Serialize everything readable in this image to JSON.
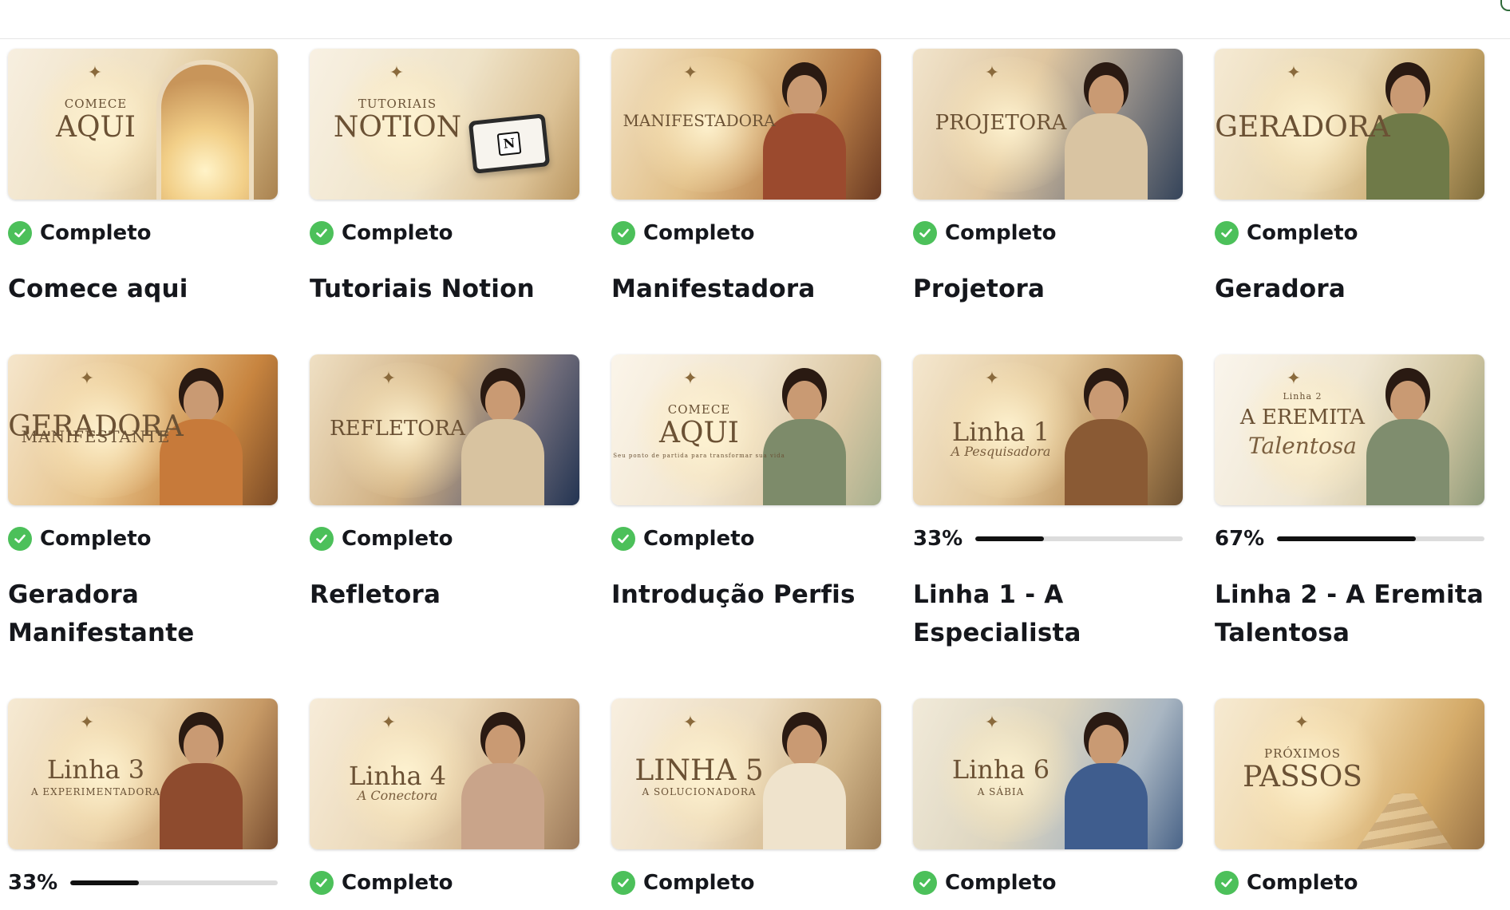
{
  "courses": [
    {
      "title": "Comece aqui",
      "status": "complete",
      "status_label": "Completo",
      "thumb": {
        "small": "COMECE",
        "big": "AQUI",
        "italic": "",
        "extra": ""
      }
    },
    {
      "title": "Tutoriais Notion",
      "status": "complete",
      "status_label": "Completo",
      "thumb": {
        "small": "TUTORIAIS",
        "big": "NOTION",
        "italic": "",
        "extra": ""
      }
    },
    {
      "title": "Manifestadora",
      "status": "complete",
      "status_label": "Completo",
      "thumb": {
        "small": "",
        "big": "MANIFESTADORA",
        "italic": "",
        "extra": ""
      }
    },
    {
      "title": "Projetora",
      "status": "complete",
      "status_label": "Completo",
      "thumb": {
        "small": "",
        "big": "PROJETORA",
        "italic": "",
        "extra": ""
      }
    },
    {
      "title": "Geradora",
      "status": "complete",
      "status_label": "Completo",
      "thumb": {
        "small": "",
        "big": "GERADORA",
        "italic": "",
        "extra": ""
      }
    },
    {
      "title": "Geradora Manifestante",
      "status": "complete",
      "status_label": "Completo",
      "thumb": {
        "small": "",
        "big": "GERADORA",
        "italic": "",
        "extra": "MANIFESTANTE"
      }
    },
    {
      "title": "Refletora",
      "status": "complete",
      "status_label": "Completo",
      "thumb": {
        "small": "",
        "big": "REFLETORA",
        "italic": "",
        "extra": ""
      }
    },
    {
      "title": "Introdução Perfis",
      "status": "complete",
      "status_label": "Completo",
      "thumb": {
        "small": "COMECE",
        "big": "AQUI",
        "italic": "",
        "extra": "Seu ponto de partida para transformar sua vida"
      }
    },
    {
      "title": "Linha 1 - A Especialista",
      "status": "progress",
      "progress_label": "33%",
      "progress": 0.33,
      "thumb": {
        "small": "",
        "big": "Linha 1",
        "italic": "A Pesquisadora",
        "extra": ""
      }
    },
    {
      "title": "Linha 2 - A Eremita Talentosa",
      "status": "progress",
      "progress_label": "67%",
      "progress": 0.67,
      "thumb": {
        "small": "Linha 2",
        "big": "A EREMITA",
        "italic": "Talentosa",
        "extra": ""
      }
    },
    {
      "title": "",
      "status": "progress",
      "progress_label": "33%",
      "progress": 0.33,
      "thumb": {
        "small": "",
        "big": "Linha 3",
        "italic": "",
        "extra": "A EXPERIMENTADORA"
      }
    },
    {
      "title": "",
      "status": "complete",
      "status_label": "Completo",
      "thumb": {
        "small": "",
        "big": "Linha 4",
        "italic": "A Conectora",
        "extra": ""
      }
    },
    {
      "title": "",
      "status": "complete",
      "status_label": "Completo",
      "thumb": {
        "small": "",
        "big": "LINHA 5",
        "italic": "",
        "extra": "A SOLUCIONADORA"
      }
    },
    {
      "title": "",
      "status": "complete",
      "status_label": "Completo",
      "thumb": {
        "small": "",
        "big": "Linha 6",
        "italic": "",
        "extra": "A SÁBIA"
      }
    },
    {
      "title": "",
      "status": "complete",
      "status_label": "Completo",
      "thumb": {
        "small": "PRÓXIMOS",
        "big": "PASSOS",
        "italic": "",
        "extra": ""
      }
    }
  ],
  "colors": {
    "check_green": "#4cc05a",
    "progress_fill": "#111111",
    "progress_track": "#dcdcdc",
    "text": "#15171c"
  },
  "icons": {
    "status_complete": "check-circle-icon",
    "thumb_ornament": "compass-star-icon"
  }
}
